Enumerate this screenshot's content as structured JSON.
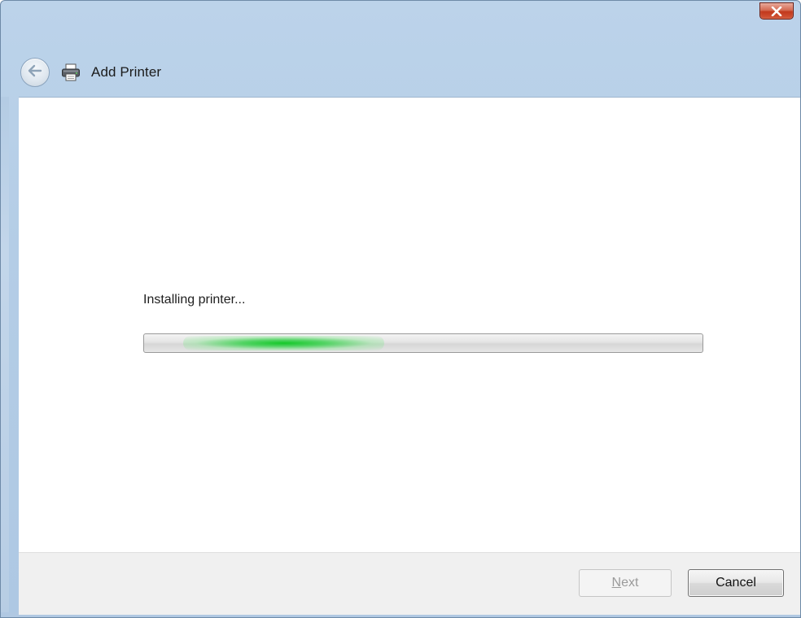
{
  "window": {
    "title": "Add Printer"
  },
  "titlebar": {
    "close_icon": "close-icon"
  },
  "header": {
    "back_icon": "back-arrow-icon",
    "app_icon": "printer-icon"
  },
  "content": {
    "status_text": "Installing printer...",
    "progress": {
      "mode": "indeterminate",
      "glow_position_fraction": 0.25,
      "color": "#22c33a"
    }
  },
  "footer": {
    "next": {
      "prefix": "",
      "mnemonic": "N",
      "rest": "ext",
      "enabled": false
    },
    "cancel_label": "Cancel"
  },
  "colors": {
    "frame": "#b4cde6",
    "close_button": "#c2381c",
    "footer_bg": "#f0f0f0"
  }
}
